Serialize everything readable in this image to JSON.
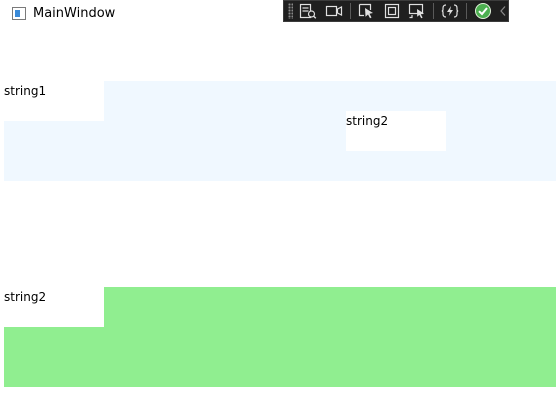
{
  "window": {
    "title": "MainWindow"
  },
  "debug_toolbar": {
    "icons": [
      "live-visual-tree-icon",
      "record-icon",
      "select-element-icon",
      "display-layout-adorners-icon",
      "track-focus-icon",
      "hot-reload-icon",
      "status-ok-icon",
      "collapse-chevron-icon"
    ],
    "status_color": "#4caf50"
  },
  "content": {
    "top_row": {
      "background": "#f0f8ff",
      "items": [
        "string1",
        "string2"
      ]
    },
    "bottom_row": {
      "background": "#90ee90",
      "items": [
        "string2"
      ]
    }
  }
}
